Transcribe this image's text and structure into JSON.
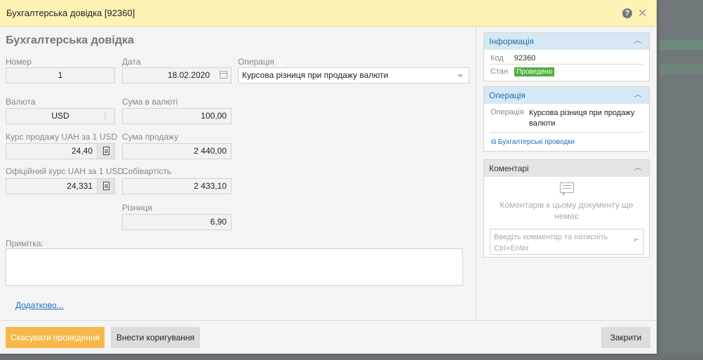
{
  "window": {
    "title": "Бухгалтерська довідка [92360]"
  },
  "form": {
    "heading": "Бухгалтерська довідка",
    "number": {
      "label": "Номер",
      "value": "1"
    },
    "date": {
      "label": "Дата",
      "value": "18.02.2020"
    },
    "operation": {
      "label": "Операція",
      "value": "Курсова різниця при продажу валюти"
    },
    "currency": {
      "label": "Валюта",
      "value": "USD"
    },
    "amount_currency": {
      "label": "Сума в валюті",
      "value": "100,00"
    },
    "sale_rate": {
      "label": "Курс продажу UAH за 1 USD",
      "value": "24,40"
    },
    "sale_amount": {
      "label": "Сума продажу",
      "value": "2 440,00"
    },
    "official_rate": {
      "label": "Офіційний курс UAH за 1 USD",
      "value": "24,331"
    },
    "cost": {
      "label": "Собівартість",
      "value": "2 433,10"
    },
    "difference": {
      "label": "Різниця",
      "value": "6,90"
    },
    "note": {
      "label": "Примітка:",
      "value": ""
    },
    "more_link": "Додатково..."
  },
  "footer": {
    "cancel_posting": "Скасувати проведення",
    "make_correction": "Внести коригування",
    "close": "Закрити"
  },
  "info_panel": {
    "title": "Інформація",
    "code_label": "Код",
    "code_value": "92360",
    "state_label": "Стан",
    "state_value": "Проведено"
  },
  "operation_panel": {
    "title": "Операція",
    "label": "Операція",
    "value": "Курсова різниця при продажу валюти",
    "link": "Бухгалтерські проводки"
  },
  "comments_panel": {
    "title": "Коментарі",
    "empty_text": "Коментарів к цьому документу ще немає",
    "placeholder": "Введіть комментар та натисніть Ctrl+Enter"
  },
  "colors": {
    "titlebar": "#fdf3b4",
    "primary_button": "#f7b84a",
    "status_badge": "#4caf3c",
    "link": "#1a6fc4"
  }
}
